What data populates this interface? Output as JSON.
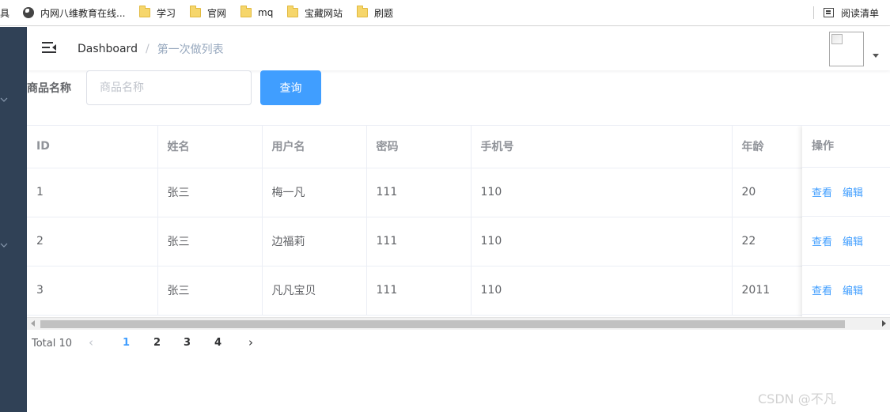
{
  "bookmarks": {
    "partial_label": "具",
    "items": [
      {
        "label": "内网八维教育在线...",
        "icon": "globe-icon"
      },
      {
        "label": "学习",
        "icon": "folder-icon"
      },
      {
        "label": "官网",
        "icon": "folder-icon"
      },
      {
        "label": "mq",
        "icon": "folder-icon"
      },
      {
        "label": "宝藏网站",
        "icon": "folder-icon"
      },
      {
        "label": "刷题",
        "icon": "folder-icon"
      }
    ],
    "reading_list": "阅读清单"
  },
  "breadcrumb": {
    "root": "Dashboard",
    "separator": "/",
    "current": "第一次做列表"
  },
  "search": {
    "label": "商品名称",
    "placeholder": "商品名称",
    "value": "",
    "button_label": "查询"
  },
  "table": {
    "columns": [
      "ID",
      "姓名",
      "用户名",
      "密码",
      "手机号",
      "年龄"
    ],
    "actions_header": "操作",
    "rows": [
      {
        "id": "1",
        "name": "张三",
        "username": "梅一凡",
        "password": "111",
        "phone": "110",
        "age": "20"
      },
      {
        "id": "2",
        "name": "张三",
        "username": "边福莉",
        "password": "111",
        "phone": "110",
        "age": "22"
      },
      {
        "id": "3",
        "name": "张三",
        "username": "凡凡宝贝",
        "password": "111",
        "phone": "110",
        "age": "2011"
      }
    ],
    "actions": {
      "view": "查看",
      "edit": "编辑"
    }
  },
  "pagination": {
    "total_text": "Total 10",
    "pages": [
      "1",
      "2",
      "3",
      "4"
    ],
    "current_page": "1",
    "prev": "‹",
    "next": "›"
  },
  "watermark": "CSDN @不凡",
  "colors": {
    "sidebar": "#304156",
    "primary": "#409eff",
    "border": "#ebeef5"
  }
}
